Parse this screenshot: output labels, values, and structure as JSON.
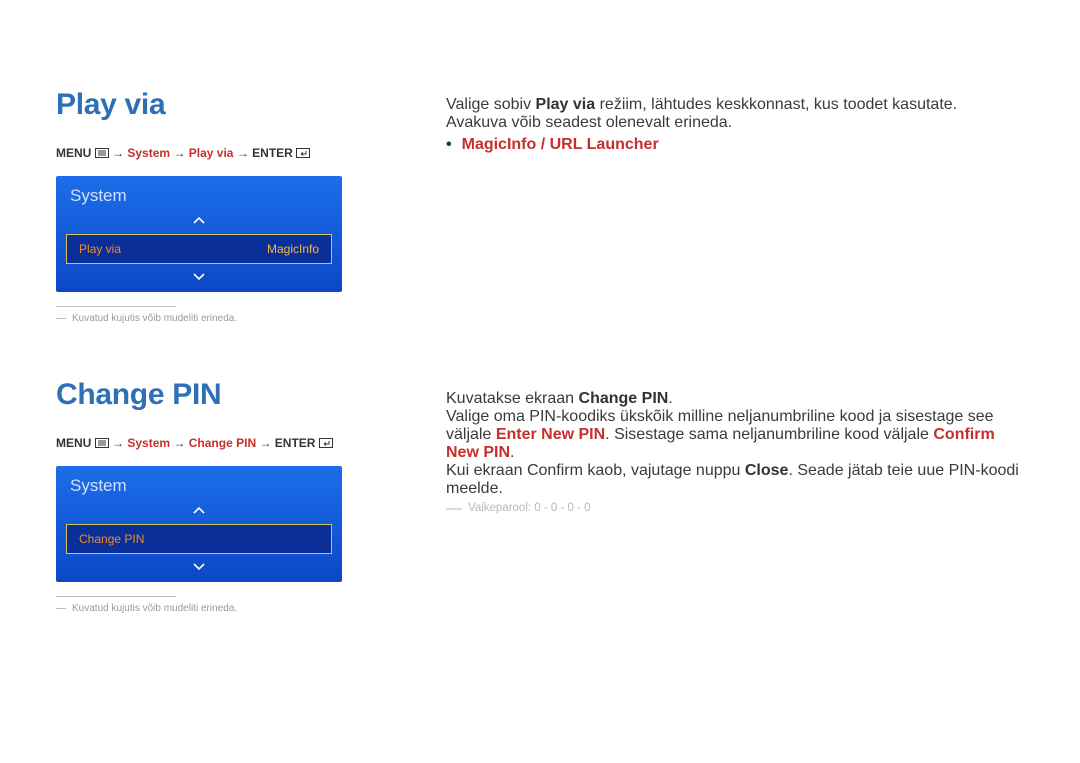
{
  "section1": {
    "title": "Play via",
    "breadcrumb": {
      "menu": "MENU",
      "path1": "System",
      "path2": "Play via",
      "enter": "ENTER"
    },
    "panel": {
      "header": "System",
      "row_label": "Play via",
      "row_value": "MagicInfo"
    },
    "footnote": "Kuvatud kujutis võib mudeliti erineda.",
    "body": {
      "line1_a": "Valige sobiv ",
      "line1_b": "Play via",
      "line1_c": " režiim, lähtudes keskkonnast, kus toodet kasutate.",
      "line2": "Avakuva võib seadest olenevalt erineda.",
      "bullet": "MagicInfo / URL Launcher"
    }
  },
  "section2": {
    "title": "Change PIN",
    "breadcrumb": {
      "menu": "MENU",
      "path1": "System",
      "path2": "Change PIN",
      "enter": "ENTER"
    },
    "panel": {
      "header": "System",
      "row_label": "Change PIN"
    },
    "footnote": "Kuvatud kujutis võib mudeliti erineda.",
    "body": {
      "line1_a": "Kuvatakse ekraan ",
      "line1_b": "Change PIN",
      "line1_c": ".",
      "line2_a": "Valige oma PIN-koodiks ükskõik milline neljanumbriline kood ja sisestage see väljale ",
      "line2_b": "Enter New PIN",
      "line2_c": ". Sisestage sama neljanumbriline kood väljale ",
      "line2_d": "Confirm New PIN",
      "line2_e": ".",
      "line3_a": "Kui ekraan Confirm kaob, vajutage nuppu ",
      "line3_b": "Close",
      "line3_c": ". Seade jätab teie uue PIN-koodi meelde.",
      "note": "Vaikeparool: 0 - 0 - 0 - 0"
    }
  }
}
